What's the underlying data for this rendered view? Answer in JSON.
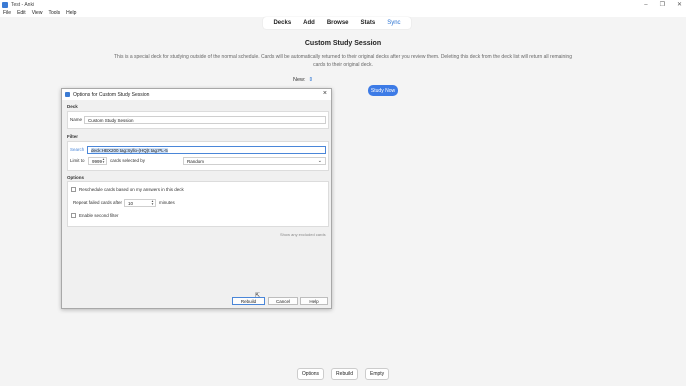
{
  "window": {
    "title": "Test - Anki",
    "controls": [
      "–",
      "❐",
      "✕"
    ]
  },
  "menu": [
    "File",
    "Edit",
    "View",
    "Tools",
    "Help"
  ],
  "toolbar": {
    "items": [
      "Decks",
      "Add",
      "Browse",
      "Stats",
      "Sync"
    ]
  },
  "overview": {
    "title": "Custom Study Session",
    "description": "This is a special deck for studying outside of the normal schedule. Cards will be automatically returned to their original decks after you review them. Deleting this deck from the deck list will return all remaining cards to their original deck.",
    "new_label": "New:",
    "study_now": "Study Now"
  },
  "bottom": {
    "options": "Options",
    "rebuild": "Rebuild",
    "empty": "Empty"
  },
  "dialog": {
    "title": "Options for Custom Study Session",
    "deck_group": "Deck",
    "name_label": "Name",
    "name_value": "Custom Study Session",
    "filter_group": "Filter",
    "search_label": "Search",
    "search_value": "deck:HBX200 tag:Syllo-(HQ)t tag:PL-5",
    "limit_label": "Limit to",
    "limit_value": "9999",
    "selected_by_label": "cards selected by",
    "order_value": "Random",
    "options_group": "Options",
    "reschedule_label": "Reschedule cards based on my answers in this deck",
    "repeat_label": "Repeat failed cards after",
    "repeat_value": "10",
    "minutes_label": "minutes",
    "second_filter_label": "Enable second filter",
    "show_excluded": "Show any excluded cards",
    "rebuild_btn": "Rebuild",
    "cancel_btn": "Cancel",
    "help_btn": "Help"
  }
}
